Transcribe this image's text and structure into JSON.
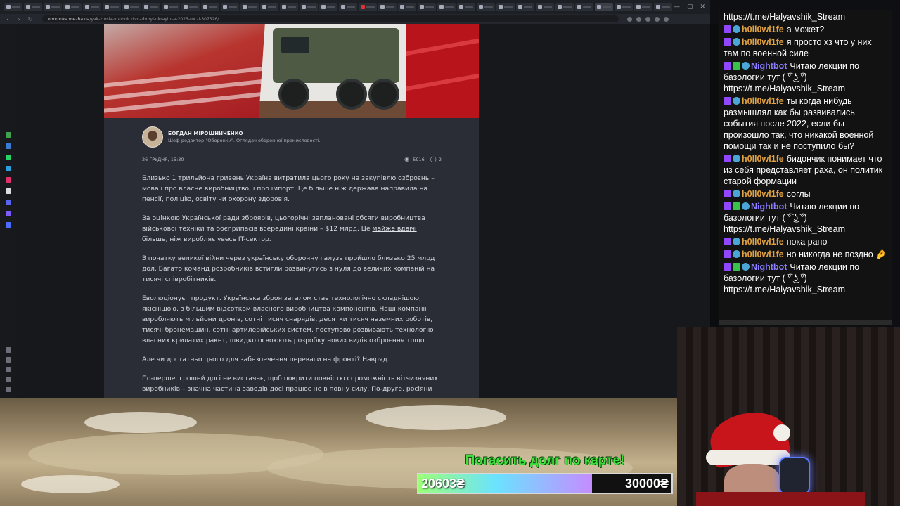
{
  "browser": {
    "url_host": "oboronka.mezha.ua",
    "url_path": "/yak-zrosla-vnobnicztvo-zbroyi-ukrayini-v-2025-roczi-307326/"
  },
  "article": {
    "author_name": "БОГДАН МІРОШНИЧЕНКО",
    "author_role": "Шеф-редактор \"Оборонки\". Оглядач оборонної промисловості.",
    "date": "26 ГРУДНЯ, 15:30",
    "views": "5916",
    "comments": "2",
    "p1_a": "Близько 1 трильйона гривень Україна ",
    "p1_link": "витратила",
    "p1_b": " цього року на закупівлю озброєнь – мова і про власне виробництво, і про імпорт. Це більше ніж держава направила на пенсії, поліцію, освіту чи охорону здоров'я.",
    "p2_a": "За оцінкою Української ради зброярів, цьогорічні заплановані обсяги виробництва військової техніки та боєприпасів всередині країни – $12 млрд. Це ",
    "p2_link": "майже вдвічі більше",
    "p2_b": ", ніж виробляє увесь IT-сектор.",
    "p3": "З початку великої війни через українську оборонну галузь пройшло близько 25 млрд дол. Багато команд розробників встигли розвинутись з нуля до великих компаній на тисячі співробітників.",
    "p4": "Еволюціонує і продукт. Українська зброя загалом стає технологічно складнішою, якіснішою, з більшим відсотком власного виробництва компонентів. Наші компанії виробляють мільйони дронів, сотні тисяч снарядів, десятки тисяч наземних роботів, тисячі бронемашин, сотні артилерійських систем, поступово розвивають технологію власних крилатих ракет, швидко освоюють розробку нових видів озброєння тощо.",
    "p5": "Але чи достатньо цього для забезпечення переваги на фронті? Навряд.",
    "p6": "По-перше, грошей досі не вистачає, щоб покрити повністю спроможність вітчизняних виробників – значна частина заводів досі працює не в повну силу. По-друге, росіяни"
  },
  "chat": {
    "messages": [
      {
        "user": "",
        "text": "https://t.me/Halyavshik_Stream"
      },
      {
        "user": "h0ll0wl1fe",
        "text": "а может?"
      },
      {
        "user": "h0ll0wl1fe",
        "text": "я просто хз что у них там по военной силе"
      },
      {
        "user": "Nightbot",
        "text": "Читаю лекции по базологии тут ( ͡° ͜ʖ ͡°) https://t.me/Halyavshik_Stream"
      },
      {
        "user": "h0ll0wl1fe",
        "text": "ты когда нибудь размышлял как бы развивались события после 2022, если бы произошло так, что никакой военной помощи так и не поступило бы?"
      },
      {
        "user": "h0ll0wl1fe",
        "text": "бидончик понимает что из себя представляет раха, он политик старой формации"
      },
      {
        "user": "h0ll0wl1fe",
        "text": "соглы"
      },
      {
        "user": "Nightbot",
        "text": "Читаю лекции по базологии тут ( ͡° ͜ʖ ͡°) https://t.me/Halyavshik_Stream"
      },
      {
        "user": "h0ll0wl1fe",
        "text": "пока рано"
      },
      {
        "user": "h0ll0wl1fe",
        "text": "но никогда не поздно 🤌"
      },
      {
        "user": "Nightbot",
        "text": "Читаю лекции по базологии тут ( ͡° ͜ʖ ͡°) https://t.me/Halyavshik_Stream"
      }
    ]
  },
  "donation": {
    "title": "Погасить долг по карте!",
    "current": "20603₴",
    "target": "30000₴",
    "progress": 0.6868
  },
  "colors": {
    "goal_green": "#3ee23a",
    "chat_user_h": "#e0a243",
    "chat_user_nightbot": "#8a7dff",
    "hero_red": "#b61e24"
  }
}
